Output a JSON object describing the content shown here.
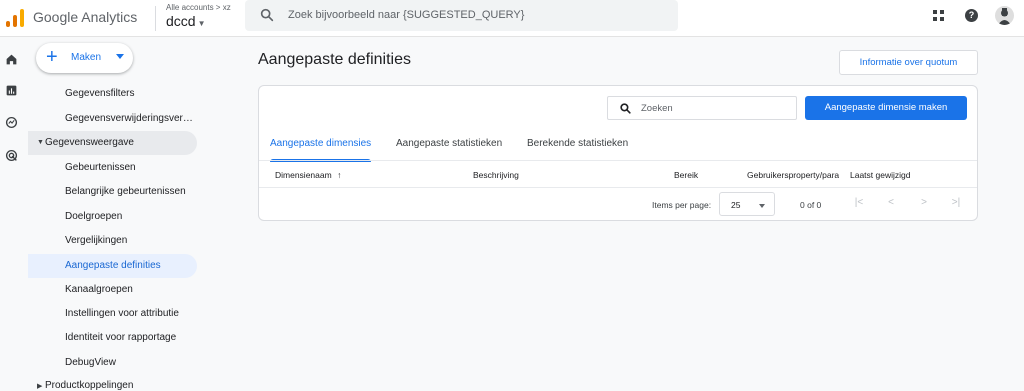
{
  "app": {
    "brand": "Google Analytics",
    "accounts_label": "Alle accounts > xz",
    "property_name": "dccd",
    "logo_colors": [
      "#f9ab00",
      "#e37400",
      "#e37400"
    ]
  },
  "search": {
    "placeholder": "Zoek bijvoorbeeld naar {SUGGESTED_QUERY}"
  },
  "header_icons": [
    "apps-icon",
    "help-icon",
    "avatar"
  ],
  "rail_icons": [
    "home-icon",
    "reports-icon",
    "explore-icon",
    "advertising-icon"
  ],
  "nav": {
    "create_label": "Maken",
    "items": [
      {
        "label": "Gegevensfilters",
        "type": "child"
      },
      {
        "label": "Gegevensverwijderingsverzoeken",
        "type": "child"
      },
      {
        "label": "Gegevensweergave",
        "type": "group",
        "expanded": true
      },
      {
        "label": "Gebeurtenissen",
        "type": "child"
      },
      {
        "label": "Belangrijke gebeurtenissen",
        "type": "child"
      },
      {
        "label": "Doelgroepen",
        "type": "child"
      },
      {
        "label": "Vergelijkingen",
        "type": "child"
      },
      {
        "label": "Aangepaste definities",
        "type": "child",
        "active": true
      },
      {
        "label": "Kanaalgroepen",
        "type": "child"
      },
      {
        "label": "Instellingen voor attributie",
        "type": "child"
      },
      {
        "label": "Identiteit voor rapportage",
        "type": "child"
      },
      {
        "label": "DebugView",
        "type": "child"
      },
      {
        "label": "Productkoppelingen",
        "type": "group",
        "expanded": false
      }
    ]
  },
  "main": {
    "title": "Aangepaste definities",
    "quota_button": "Informatie over quotum",
    "search_placeholder": "Zoeken",
    "create_button": "Aangepaste dimensie maken",
    "tabs": [
      {
        "label": "Aangepaste dimensies",
        "active": true
      },
      {
        "label": "Aangepaste statistieken",
        "active": false
      },
      {
        "label": "Berekende statistieken",
        "active": false
      }
    ],
    "table": {
      "columns": [
        "Dimensienaam",
        "Beschrijving",
        "Bereik",
        "Gebruikersproperty/paran",
        "Laatst gewijzigd"
      ],
      "sort_indicator": "↑",
      "rows": []
    },
    "pagination": {
      "items_per_page_label": "Items per page:",
      "items_per_page_value": "25",
      "range": "0 of 0",
      "first": "|<",
      "prev": "<",
      "next": ">",
      "last": ">|"
    }
  },
  "colors": {
    "accent": "#1a73e8",
    "active_nav_bg": "#e8f0fe",
    "active_nav_text": "#1967d2"
  }
}
